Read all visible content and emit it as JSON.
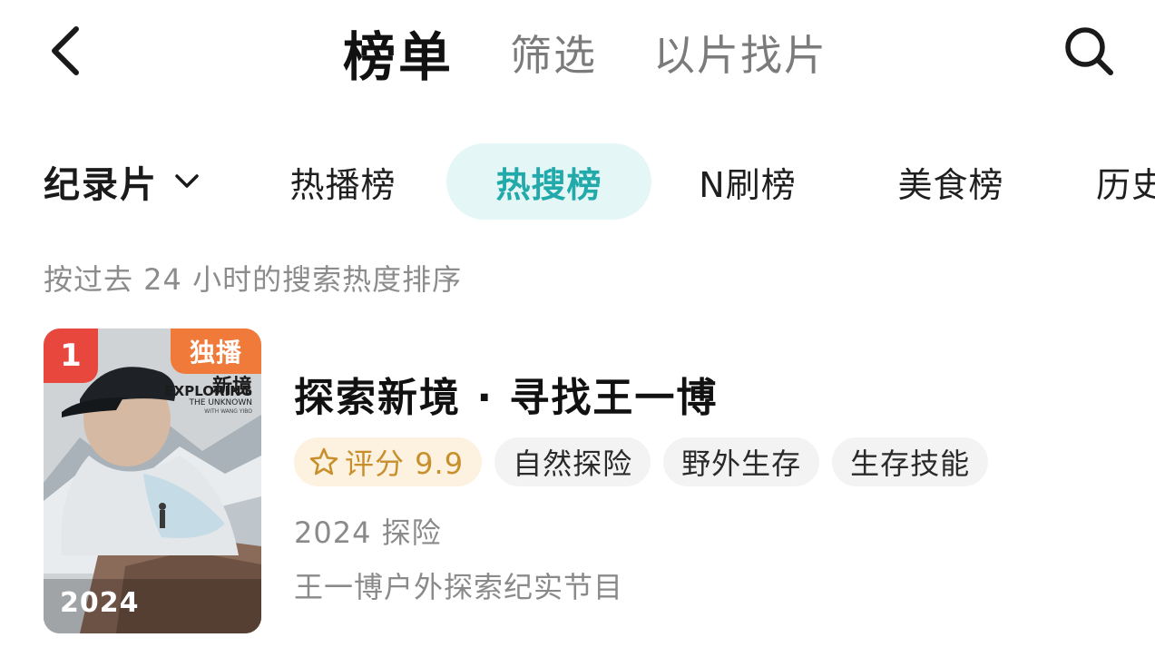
{
  "header": {
    "back_icon": "chevron-left-icon",
    "tabs": [
      {
        "label": "榜单",
        "active": true
      },
      {
        "label": "筛选",
        "active": false
      },
      {
        "label": "以片找片",
        "active": false
      }
    ],
    "search_icon": "search-icon"
  },
  "category_bar": {
    "dropdown_label": "纪录片",
    "dropdown_icon": "chevron-down-icon",
    "chips": [
      {
        "label": "热播榜",
        "active": false
      },
      {
        "label": "热搜榜",
        "active": true
      },
      {
        "label": "N刷榜",
        "active": false
      },
      {
        "label": "美食榜",
        "active": false
      },
      {
        "label": "历史",
        "active": false
      }
    ],
    "accent_color": "#22a9a9",
    "active_chip_bg": "#e4f6f6"
  },
  "sort_hint": "按过去 24 小时的搜索热度排序",
  "list": [
    {
      "rank": "1",
      "badge": "独播",
      "poster": {
        "title_cn": "新境",
        "title_en_1": "EXPLORING",
        "title_en_2": "THE UNKNOWN",
        "title_en_3": "WITH WANG YIBO",
        "year": "2024"
      },
      "title": "探索新境 · 寻找王一博",
      "rating_label": "评分 9.9",
      "rating_icon": "star-icon",
      "tags": [
        "自然探险",
        "野外生存",
        "生存技能"
      ],
      "meta": "2024 探险",
      "description": "王一博户外探索纪实节目",
      "colors": {
        "rank_badge": "#e8473e",
        "exclusive_badge": "#f07a3a",
        "rating_text": "#c8902c"
      }
    }
  ]
}
